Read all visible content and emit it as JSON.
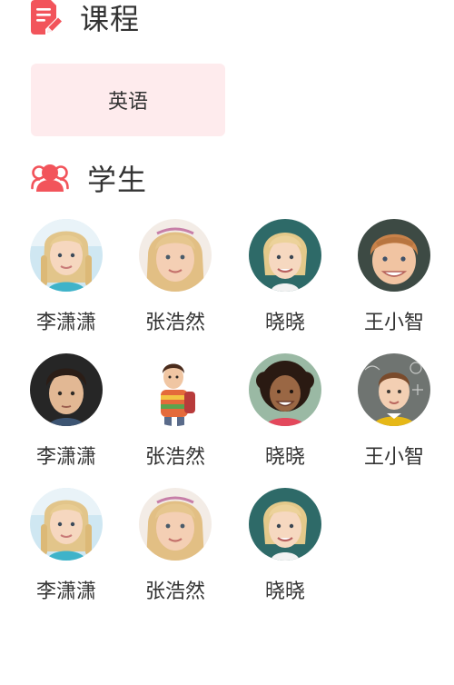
{
  "course_section": {
    "title": "课程",
    "icon": "edit-document-icon",
    "icon_color": "#f2545b",
    "courses": [
      {
        "label": "英语",
        "bg_color": "#feebed"
      }
    ]
  },
  "students_section": {
    "title": "学生",
    "icon": "users-icon",
    "icon_color": "#f2545b",
    "students": [
      {
        "name": "李潇潇",
        "avatar": "blonde-girl-braids"
      },
      {
        "name": "张浩然",
        "avatar": "blonde-girl-smile"
      },
      {
        "name": "晓晓",
        "avatar": "blonde-girl-teal-bg"
      },
      {
        "name": "王小智",
        "avatar": "ginger-boy"
      },
      {
        "name": "李潇潇",
        "avatar": "dark-haired-boy"
      },
      {
        "name": "张浩然",
        "avatar": "boy-with-backpack"
      },
      {
        "name": "晓晓",
        "avatar": "curly-haired-girl"
      },
      {
        "name": "王小智",
        "avatar": "boy-chalkboard"
      },
      {
        "name": "李潇潇",
        "avatar": "blonde-girl-braids"
      },
      {
        "name": "张浩然",
        "avatar": "blonde-girl-smile"
      },
      {
        "name": "晓晓",
        "avatar": "blonde-girl-teal-bg"
      }
    ]
  }
}
